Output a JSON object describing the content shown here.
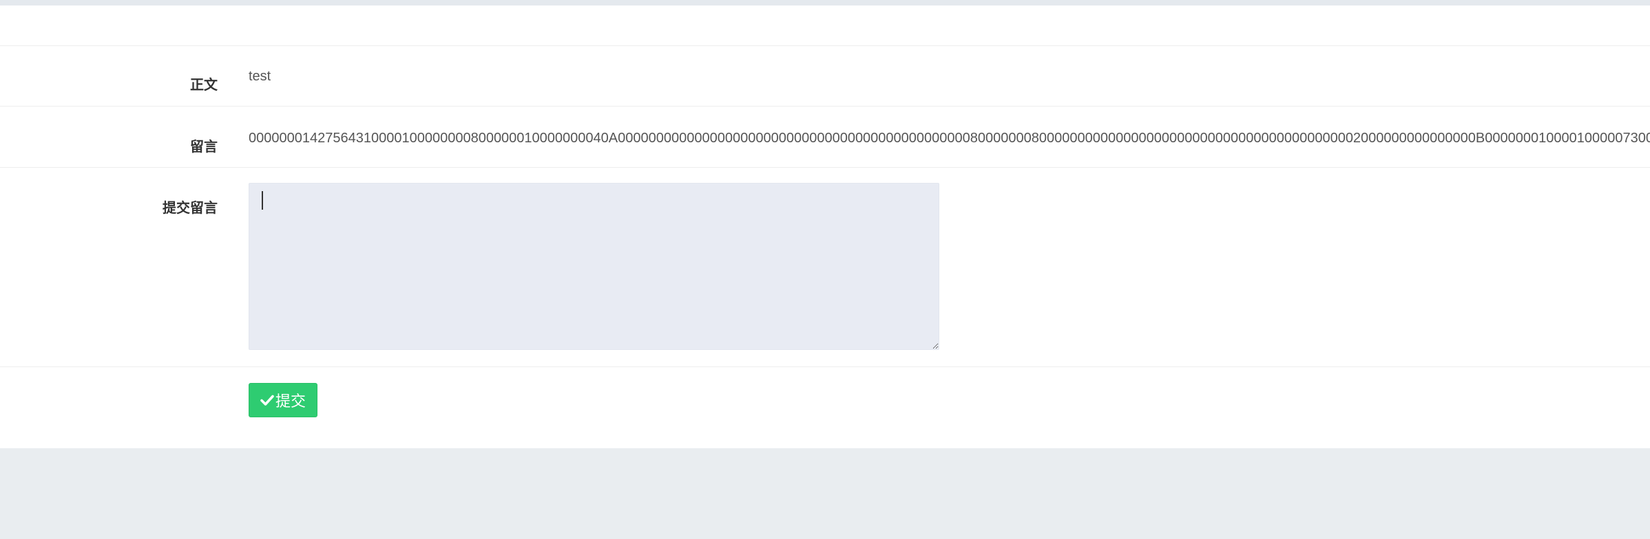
{
  "form": {
    "content_label": "正文",
    "content_value": "test",
    "comment_label": "留言",
    "comment_value": "00000001427564310000100000000800000010000000040A0000000000000000000000000000000000000000000000800000008000000000000000000000000000000000000000002000000000000000B0000000100001000007300",
    "submit_comment_label": "提交留言",
    "comment_input_value": "",
    "submit_button_label": "提交",
    "submit_button_icon": "check-icon"
  },
  "colors": {
    "primary_button": "#2ecc71",
    "textarea_bg": "#e8ebf3",
    "page_bg": "#e9edf0"
  }
}
